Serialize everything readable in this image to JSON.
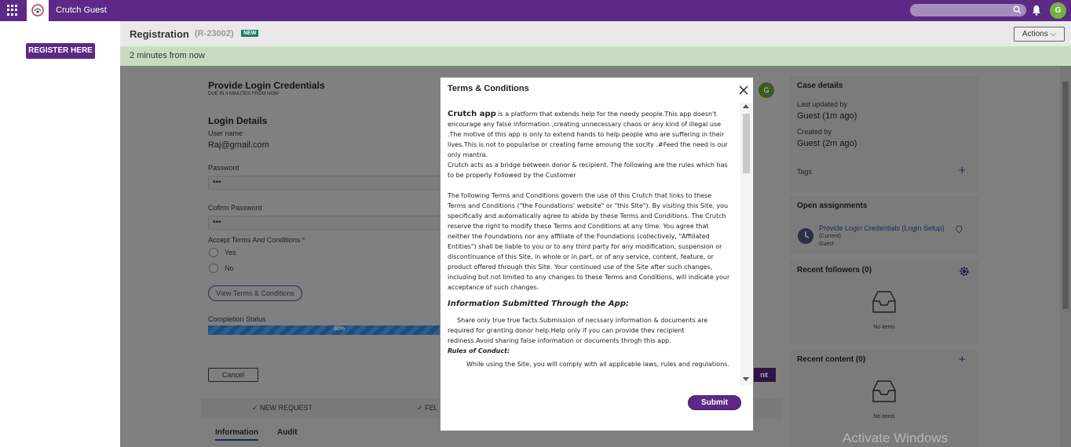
{
  "colors": {
    "brand": "#5c2a86",
    "green_banner": "#c9dcc2",
    "avatar": "#76b043"
  },
  "topbar": {
    "app_name": "Crutch Guest",
    "avatar_initial": "G"
  },
  "left_panel": {
    "register_label": "REGISTER HERE"
  },
  "header": {
    "title": "Registration",
    "case_id": "(R-23002)",
    "badge": "NEW",
    "actions_label": "Actions"
  },
  "banner": {
    "text": "2 minutes from now"
  },
  "form": {
    "title": "Provide Login Credentials",
    "due": "DUE IN 4 MINUTES FROM NOW",
    "section": "Login Details",
    "username_label": "User name",
    "username_value": "Raj@gmail.com",
    "password_label": "Password",
    "password_value": "•••",
    "confirm_label": "Cofirm Password",
    "confirm_value": "•••",
    "terms_label": "Accept Terms And Conditions",
    "required_mark": "*",
    "radio_yes": "Yes",
    "radio_no": "No",
    "view_terms": "View Terms & Conditions",
    "completion_label": "Completion Status",
    "completion_value": "80%",
    "cancel": "Cancel",
    "submit_partial": "nit",
    "assignee_initial": "G"
  },
  "stages": {
    "stage1": "NEW REQUEST",
    "stage2": "FEL"
  },
  "tabs": [
    "Information",
    "Audit"
  ],
  "case_details": {
    "title": "Case details",
    "updated_label": "Last updated by",
    "updated_value": "Guest (1m ago)",
    "created_label": "Created by",
    "created_value": "Guest (2m ago)",
    "tags_label": "Tags"
  },
  "assignments": {
    "title": "Open assignments",
    "item": "Provide Login Credentials (Login Setup)",
    "status": "(Current)",
    "user": "Guest"
  },
  "followers": {
    "title": "Recent followers (0)",
    "empty": "No items"
  },
  "content": {
    "title": "Recent content (0)",
    "empty": "No items"
  },
  "watermark": "Activate Windows",
  "modal": {
    "title": "Terms & Conditions",
    "brand": "Crutch app",
    "p1": " is a platform that extends help for the needy people.This app doesn't encourage any false information ,creating unnecessary chaos or any kind of illegal use .The motive of this app is only to extend hands to help people who are suffering in their lives.This is not to popularise or creating fame amoung the socity .#Feed the need is our only mantra.",
    "p2": "Crutch acts as a bridge between donor & recipient. The following are the rules which has to be properly Followed by the Customer",
    "p3": "The following Terms and Conditions govern the use of this Crutch  that links to these Terms and Conditions (\"the Foundations' website\" or \"this Site\"). By visiting this Site, you specifically and automatically agree to abide by these Terms and Conditions. The Crutch reserve the right to modify these Terms and Conditions at any time. You agree that neither the Foundations nor any affiliate of the Foundations (collectively, \"Affiliated Entities\") shall be liable to you or to any third party for any modification, suspension or discontinuance of this Site, in whole or in part, or of any service, content, feature, or product offered through this Site. Your continued use of the Site after such changes, including but not limited to any changes to these Terms and Conditions, will indicate your acceptance of such changes.",
    "section_title": "Information Submitted Through the App:",
    "p4": "Share only true true facts.Submission of necssary information & documents are required for granting donor help.Help only if you can provide thev recipient rediness.Avoid sharing false information or documents throgh this app.",
    "rules": "Rules of Conduct:",
    "p5": "While using the Site, you will comply with all applicable laws, rules and regulations.",
    "submit": "Submit"
  }
}
